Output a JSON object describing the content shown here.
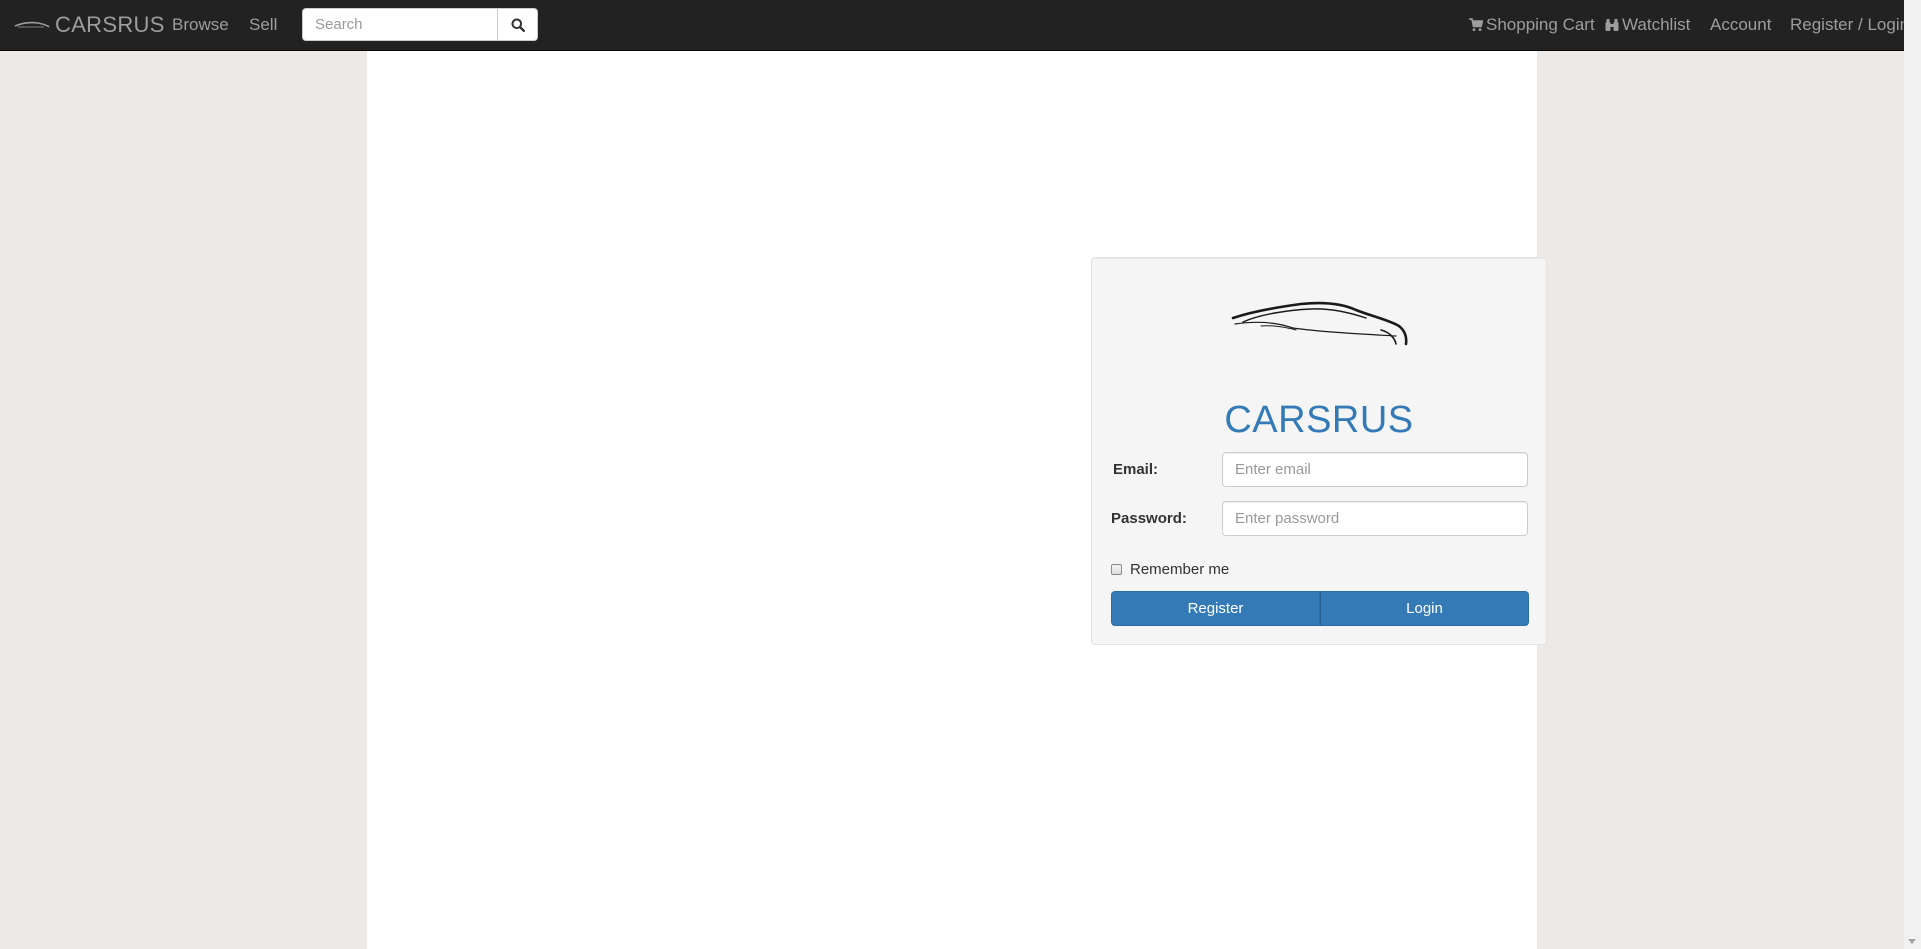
{
  "navbar": {
    "brand": "CARSRUS",
    "links": {
      "browse": "Browse",
      "sell": "Sell",
      "shopping_cart": "Shopping Cart",
      "watchlist": "Watchlist",
      "account": "Account",
      "register_login": "Register / Login"
    },
    "search": {
      "placeholder": "Search",
      "icon": "search-icon"
    },
    "icons": {
      "cart": "shopping-cart-icon",
      "watchlist": "binoculars-icon",
      "brand": "car-silhouette-icon"
    }
  },
  "login": {
    "logo_icon": "car-silhouette-icon",
    "title": "CARSRUS",
    "email": {
      "label": "Email:",
      "placeholder": "Enter email",
      "value": ""
    },
    "password": {
      "label": "Password:",
      "placeholder": "Enter password",
      "value": ""
    },
    "remember_me": {
      "label": "Remember me",
      "checked": false
    },
    "register_button": "Register",
    "login_button": "Login"
  },
  "colors": {
    "navbar_bg": "#222222",
    "nav_text": "#9d9d9d",
    "primary": "#337ab7",
    "page_bg": "#ede9e6",
    "panel_bg": "#f5f5f5"
  }
}
